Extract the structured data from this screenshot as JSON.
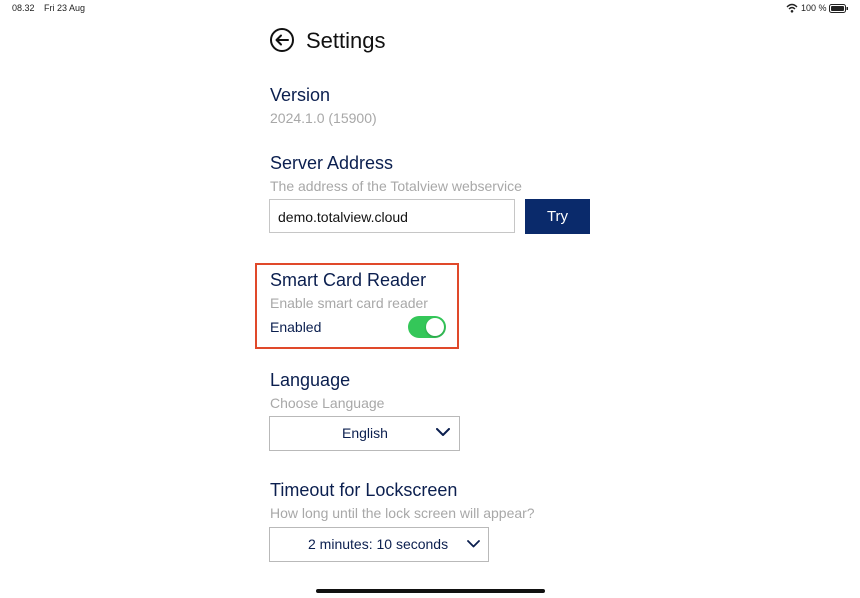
{
  "status_bar": {
    "time": "08.32",
    "date": "Fri 23 Aug",
    "battery": "100 %",
    "wifi_icon": "wifi-icon",
    "battery_icon": "battery-icon"
  },
  "header": {
    "title": "Settings",
    "back_icon": "back-arrow-icon"
  },
  "version": {
    "title": "Version",
    "value": "2024.1.0 (15900)"
  },
  "server": {
    "title": "Server Address",
    "subtitle": "The address of the Totalview webservice",
    "value": "demo.totalview.cloud",
    "try_label": "Try"
  },
  "smart_card": {
    "title": "Smart Card Reader",
    "subtitle": "Enable smart card reader",
    "toggle_label": "Enabled",
    "enabled": true
  },
  "language": {
    "title": "Language",
    "subtitle": "Choose Language",
    "selected": "English"
  },
  "timeout": {
    "title": "Timeout for Lockscreen",
    "subtitle": "How long until the lock screen will appear?",
    "selected": "2 minutes: 10 seconds"
  },
  "colors": {
    "accent": "#0a2a6b",
    "toggle_on": "#34c759",
    "highlight": "#e0492a",
    "text": "#0b1f4f",
    "subtle": "#a8a8a8"
  }
}
